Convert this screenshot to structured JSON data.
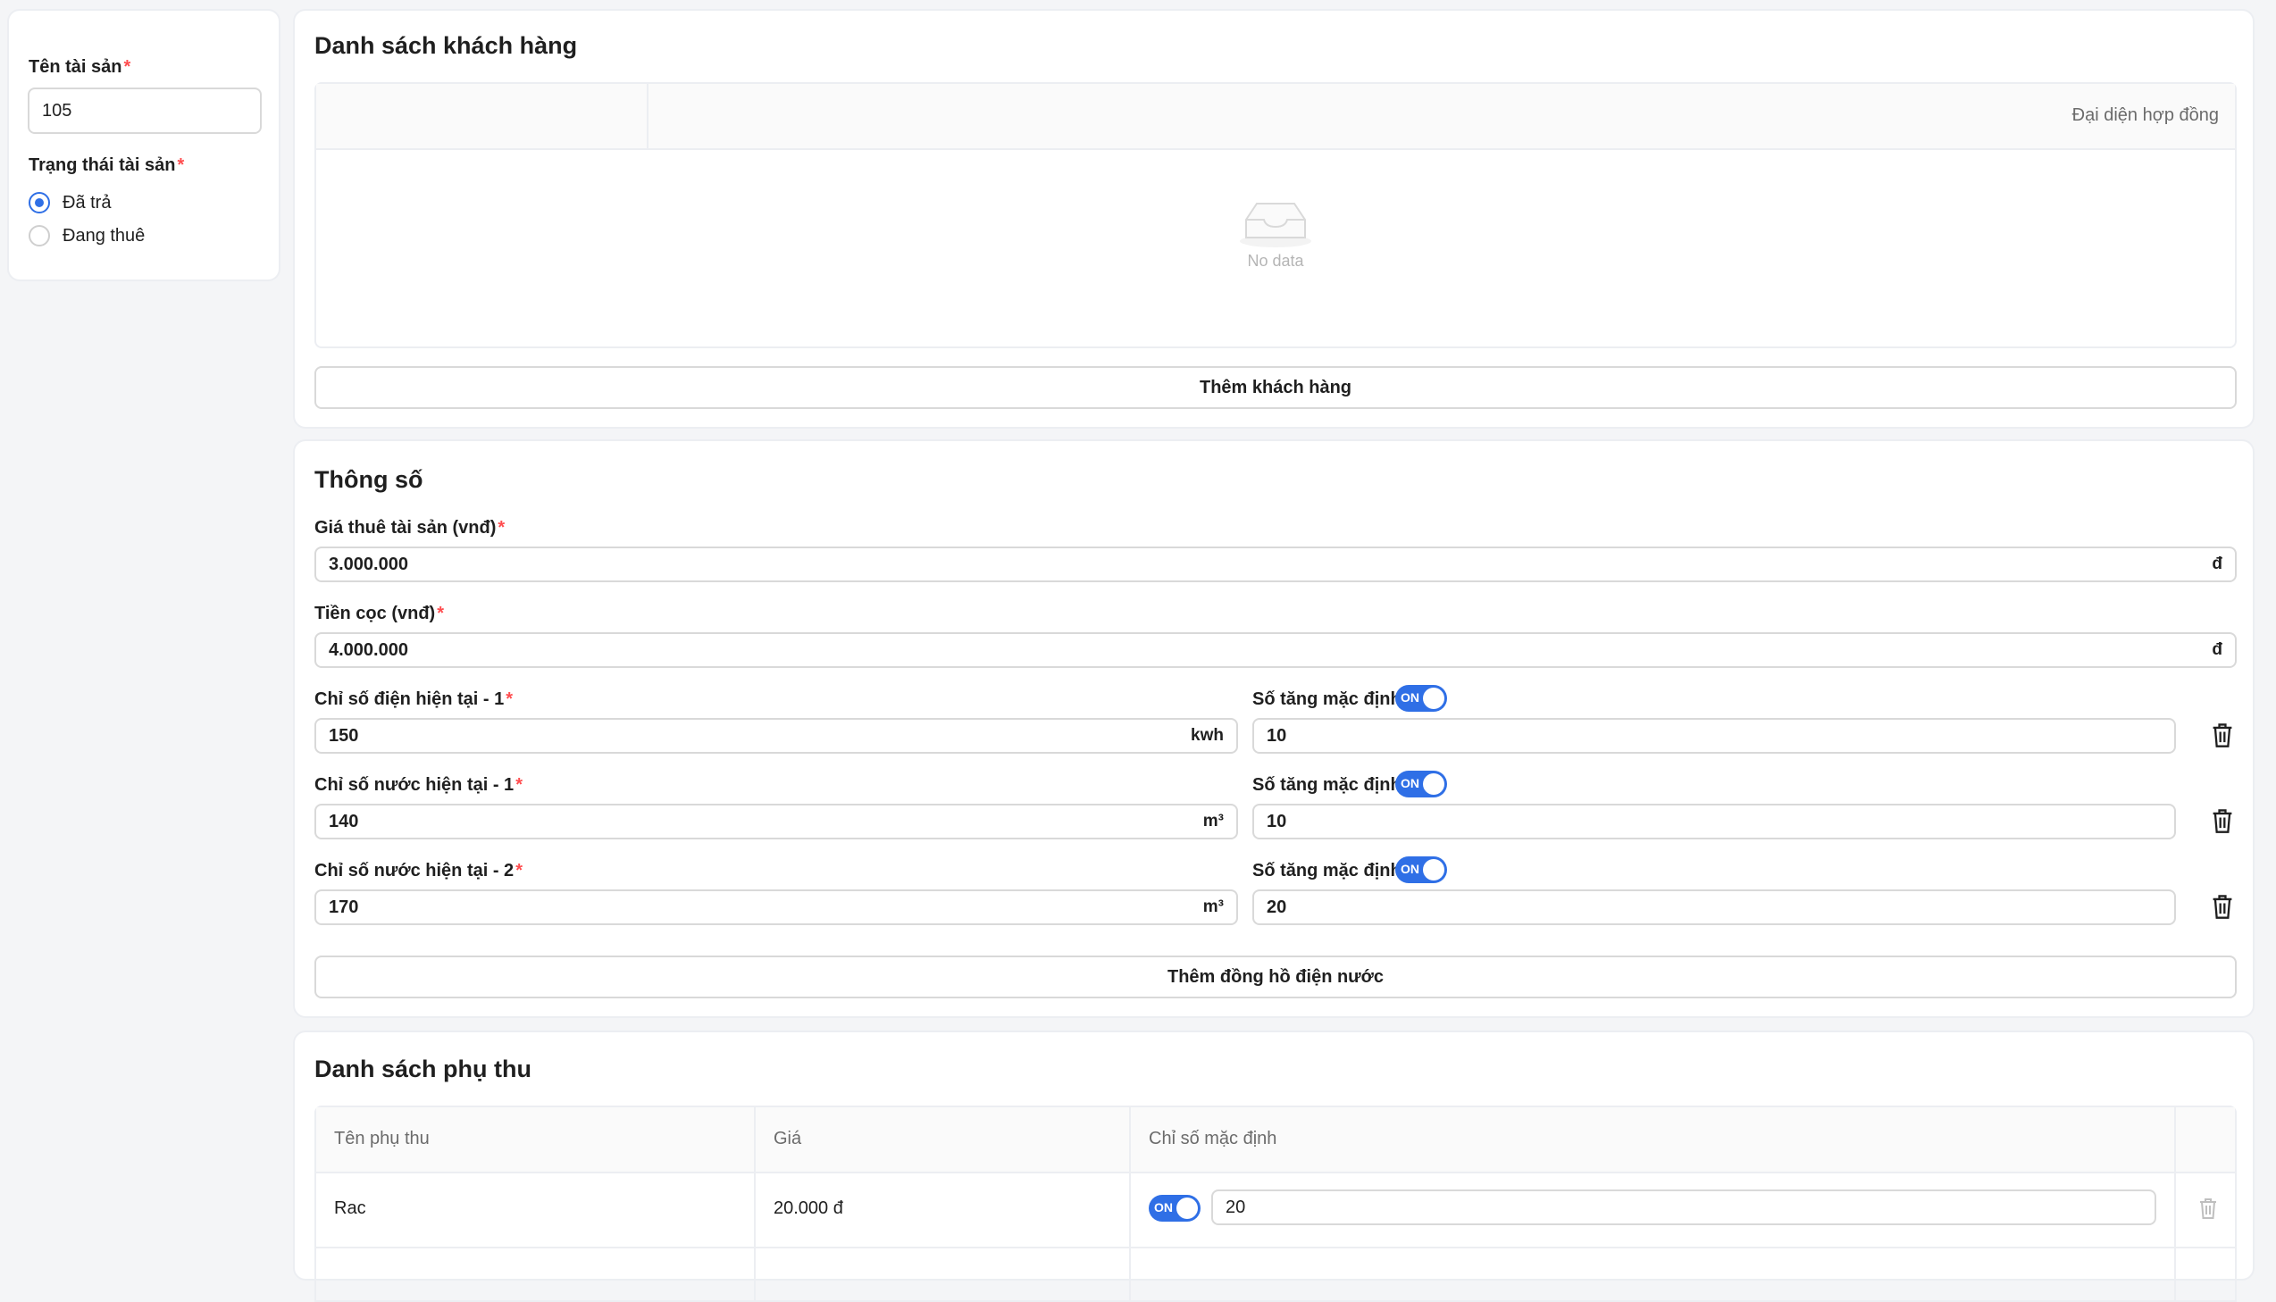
{
  "asset": {
    "name_label": "Tên tài sản",
    "name_value": "105",
    "status_label": "Trạng thái tài sản",
    "status_options": [
      "Đã trả",
      "Đang thuê"
    ],
    "status_selected": "Đã trả"
  },
  "customers": {
    "title": "Danh sách khách hàng",
    "column_header": "Đại diện hợp đồng",
    "empty_text": "No data",
    "add_button": "Thêm khách hàng"
  },
  "specs": {
    "title": "Thông số",
    "rent_label": "Giá thuê tài sản (vnđ)",
    "rent_value": "3.000.000",
    "deposit_label": "Tiền cọc (vnđ)",
    "deposit_value": "4.000.000",
    "currency_suffix": "đ",
    "meters": [
      {
        "label": "Chỉ số điện hiện tại - 1",
        "value": "150",
        "unit": "kwh",
        "increment_label": "Số tăng mặc định",
        "toggle": "ON",
        "increment_value": "10"
      },
      {
        "label": "Chỉ số nước hiện tại - 1",
        "value": "140",
        "unit": "m³",
        "increment_label": "Số tăng mặc định",
        "toggle": "ON",
        "increment_value": "10"
      },
      {
        "label": "Chỉ số nước hiện tại - 2",
        "value": "170",
        "unit": "m³",
        "increment_label": "Số tăng mặc định",
        "toggle": "ON",
        "increment_value": "20"
      }
    ],
    "add_meter_button": "Thêm đồng hồ điện nước"
  },
  "surcharges": {
    "title": "Danh sách phụ thu",
    "columns": [
      "Tên phụ thu",
      "Giá",
      "Chỉ số mặc định"
    ],
    "rows": [
      {
        "name": "Rac",
        "price": "20.000 đ",
        "toggle": "ON",
        "default_value": "20"
      }
    ]
  },
  "colors": {
    "primary": "#2f6fe6",
    "required": "#ff4d4f",
    "border": "#d9d9d9"
  }
}
